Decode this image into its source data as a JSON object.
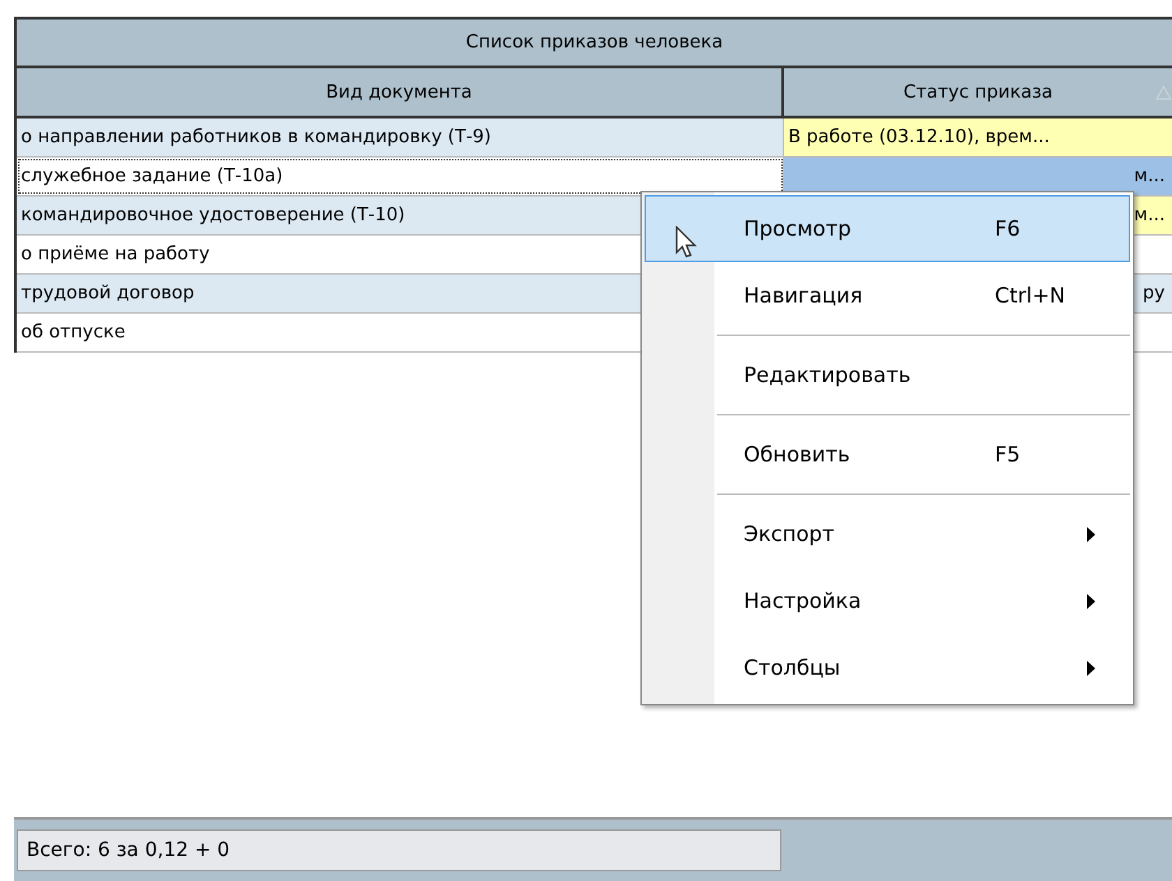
{
  "table": {
    "title": "Список приказов человека",
    "columns": [
      {
        "label": "Вид документа",
        "sorted": false
      },
      {
        "label": "Статус приказа",
        "sorted": true
      }
    ],
    "rows": [
      {
        "document": "о направлении работников в командировку (Т-9)",
        "status": "В работе (03.12.10), врем...",
        "highlighted": true,
        "focused": false,
        "selected": false
      },
      {
        "document": "служебное задание (Т-10а)",
        "status": "м...",
        "focused": true,
        "selected": true
      },
      {
        "document": "командировочное удостоверение (Т-10)",
        "status": "м...",
        "highlighted": true,
        "focused": false,
        "selected": false
      },
      {
        "document": "о приёме на работу",
        "status": "",
        "highlighted": false,
        "focused": false,
        "selected": false
      },
      {
        "document": "трудовой договор",
        "status": "ру",
        "highlighted": false,
        "focused": false,
        "selected": false
      },
      {
        "document": "об отпуске",
        "status": "",
        "highlighted": false,
        "focused": false,
        "selected": false
      }
    ]
  },
  "context_menu": {
    "items": [
      {
        "kind": "item",
        "label": "Просмотр",
        "shortcut": "F6",
        "selected": true
      },
      {
        "kind": "item",
        "label": "Навигация",
        "shortcut": "Ctrl+N",
        "selected": false
      },
      {
        "kind": "separator"
      },
      {
        "kind": "item",
        "label": "Редактировать",
        "selected": false
      },
      {
        "kind": "separator"
      },
      {
        "kind": "item",
        "label": "Обновить",
        "shortcut": "F5",
        "selected": false
      },
      {
        "kind": "separator"
      },
      {
        "kind": "submenu",
        "label": "Экспорт",
        "selected": false
      },
      {
        "kind": "submenu",
        "label": "Настройка",
        "selected": false
      },
      {
        "kind": "submenu",
        "label": "Столбцы",
        "selected": false
      }
    ]
  },
  "status_bar": {
    "text": "Всего: 6 за 0,12 + 0"
  }
}
